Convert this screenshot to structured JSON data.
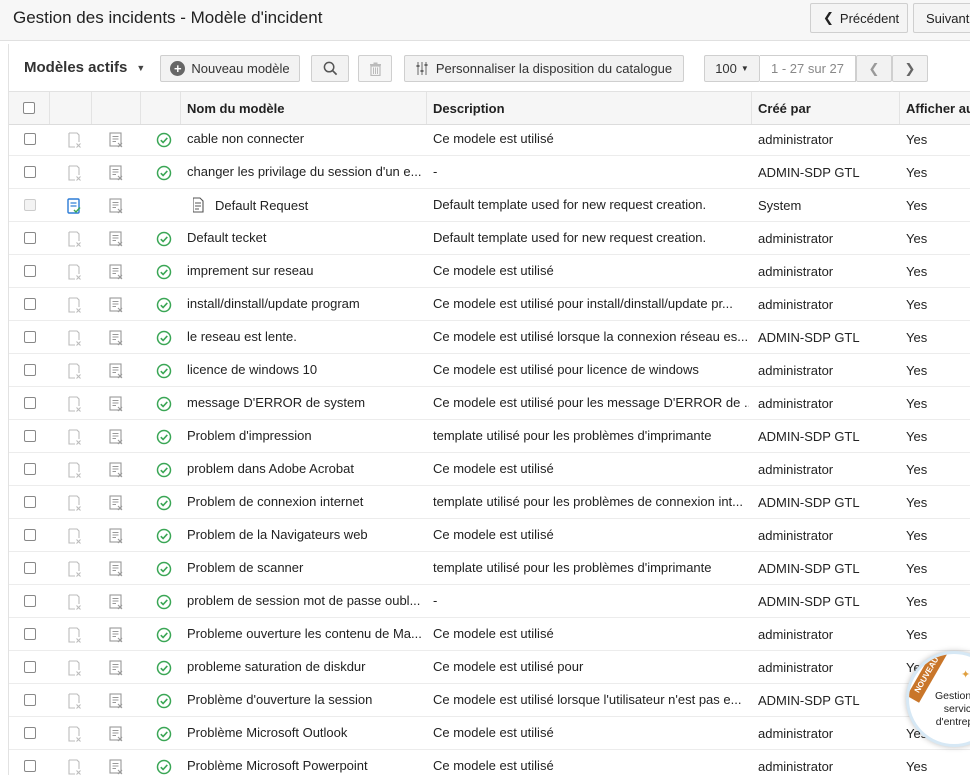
{
  "header": {
    "title": "Gestion des incidents - Modèle d'incident",
    "prev_label": "Précédent",
    "next_label": "Suivant"
  },
  "toolbar": {
    "view_label": "Modèles actifs",
    "new_label": "Nouveau modèle",
    "customize_label": "Personnaliser la disposition du catalogue",
    "page_size": "100",
    "range": "1 - 27 sur 27"
  },
  "table": {
    "columns": {
      "name": "Nom du modèle",
      "description": "Description",
      "created_by": "Créé par",
      "show": "Afficher au"
    },
    "rows": [
      {
        "name": "cable non connecter",
        "description": "Ce modele est utilisé",
        "created_by": "administrator",
        "show": "Yes",
        "default": false
      },
      {
        "name": "changer les privilage du session d'un e...",
        "description": "-",
        "created_by": "ADMIN-SDP GTL",
        "show": "Yes",
        "default": false
      },
      {
        "name": "Default Request",
        "description": "Default template used for new request creation.",
        "created_by": "System",
        "show": "Yes",
        "default": true
      },
      {
        "name": "Default tecket",
        "description": "Default template used for new request creation.",
        "created_by": "administrator",
        "show": "Yes",
        "default": false
      },
      {
        "name": "imprement sur reseau",
        "description": "Ce modele est utilisé",
        "created_by": "administrator",
        "show": "Yes",
        "default": false
      },
      {
        "name": "install/dinstall/update program",
        "description": "Ce modele est utilisé pour install/dinstall/update pr...",
        "created_by": "administrator",
        "show": "Yes",
        "default": false
      },
      {
        "name": "le reseau est lente.",
        "description": "Ce modele est utilisé lorsque la connexion réseau es...",
        "created_by": "ADMIN-SDP GTL",
        "show": "Yes",
        "default": false
      },
      {
        "name": "licence de windows 10",
        "description": "Ce modele est utilisé pour licence de windows",
        "created_by": "administrator",
        "show": "Yes",
        "default": false
      },
      {
        "name": "message D'ERROR de system",
        "description": "Ce modele est utilisé pour les message D'ERROR de ...",
        "created_by": "administrator",
        "show": "Yes",
        "default": false
      },
      {
        "name": "Problem d'impression",
        "description": "template utilisé pour les problèmes d'imprimante",
        "created_by": "ADMIN-SDP GTL",
        "show": "Yes",
        "default": false
      },
      {
        "name": "problem dans Adobe Acrobat",
        "description": "Ce modele est utilisé",
        "created_by": "administrator",
        "show": "Yes",
        "default": false
      },
      {
        "name": "Problem de connexion internet",
        "description": "template utilisé pour les problèmes de connexion int...",
        "created_by": "ADMIN-SDP GTL",
        "show": "Yes",
        "default": false
      },
      {
        "name": "Problem de la Navigateurs web",
        "description": "Ce modele est utilisé",
        "created_by": "administrator",
        "show": "Yes",
        "default": false
      },
      {
        "name": "Problem de scanner",
        "description": "template utilisé pour les problèmes d'imprimante",
        "created_by": "ADMIN-SDP GTL",
        "show": "Yes",
        "default": false
      },
      {
        "name": "problem de session mot de passe oubl...",
        "description": "-",
        "created_by": "ADMIN-SDP GTL",
        "show": "Yes",
        "default": false
      },
      {
        "name": "Probleme ouverture les contenu de Ma...",
        "description": "Ce modele est utilisé",
        "created_by": "administrator",
        "show": "Yes",
        "default": false
      },
      {
        "name": "probleme saturation de diskdur",
        "description": "Ce modele est utilisé pour",
        "created_by": "administrator",
        "show": "Yes",
        "default": false
      },
      {
        "name": "Problème d'ouverture la session",
        "description": "Ce modele est utilisé lorsque l'utilisateur n'est pas e...",
        "created_by": "ADMIN-SDP GTL",
        "show": "Yes",
        "default": false
      },
      {
        "name": "Problème Microsoft Outlook",
        "description": "Ce modele est utilisé",
        "created_by": "administrator",
        "show": "Yes",
        "default": false
      },
      {
        "name": "Problème Microsoft Powerpoint",
        "description": "Ce modele est utilisé",
        "created_by": "administrator",
        "show": "Yes",
        "default": false
      }
    ]
  },
  "badge": {
    "ribbon": "NOUVEAU",
    "text": "Gestion des services d'entreprise"
  },
  "colors": {
    "check_green": "#3aa655",
    "default_blue": "#2b7bd6",
    "ribbon": "#c9762a"
  }
}
